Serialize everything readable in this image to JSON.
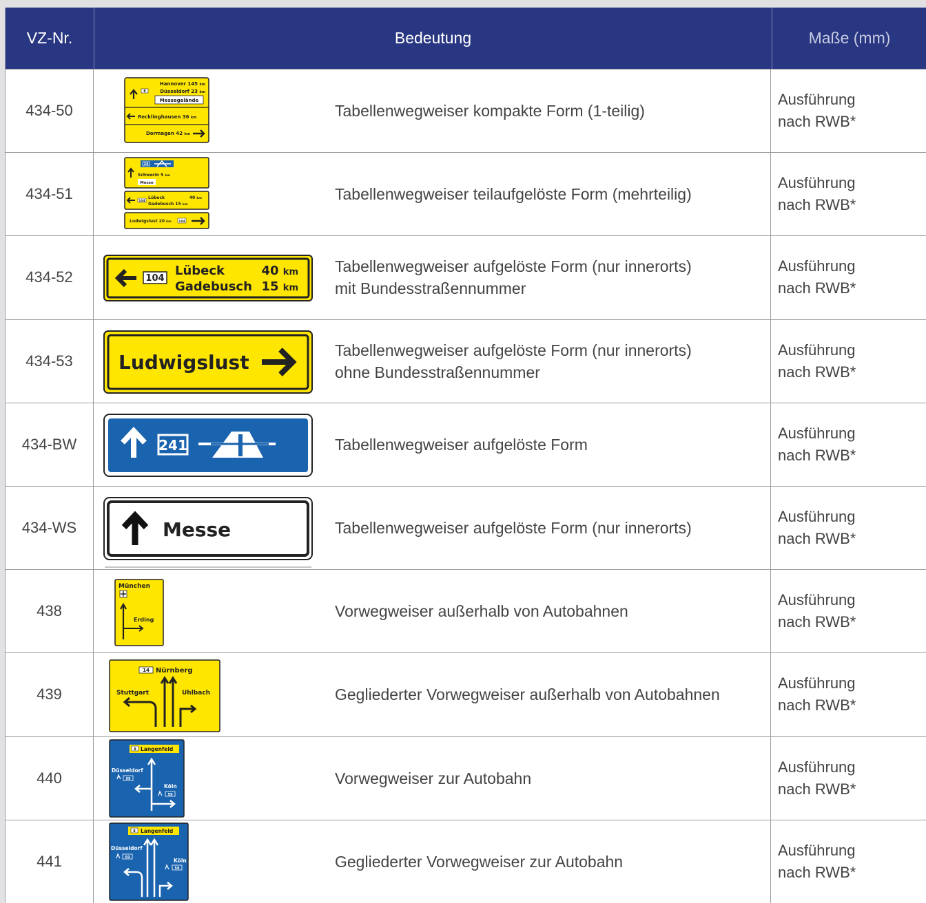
{
  "header": {
    "col_no": "VZ-Nr.",
    "col_meaning": "Bedeutung",
    "col_size": "Maße (mm)"
  },
  "rows": [
    {
      "no": "434-50",
      "meaning": "Tabellenwegweiser kompakte Form (1-teilig)",
      "size": "Ausführung\nnach RWB*",
      "sign": {
        "line1": "Hannover 145",
        "line2": "Düsseldorf 23",
        "route": "8",
        "box": "Messegelände",
        "line3": "Recklinghausen 36",
        "line4": "Dormagen 42",
        "unit": "km"
      }
    },
    {
      "no": "434-51",
      "meaning": "Tabellenwegweiser teilaufgelöste Form (mehrteilig)",
      "size": "Ausführung\nnach RWB*",
      "sign": {
        "route": "24",
        "line1": "Schwerin 5",
        "box": "Messe",
        "line2": "Lübeck",
        "km2": "40",
        "route2": "104",
        "line3": "Gadebusch 15",
        "line4": "Ludwigslust 20",
        "unit": "km"
      }
    },
    {
      "no": "434-52",
      "meaning": "Tabellenwegweiser aufgelöste Form (nur innerorts)\nmit Bundesstraßennummer",
      "size": "Ausführung\nnach RWB*",
      "sign": {
        "route": "104",
        "line1": "Lübeck",
        "km1": "40",
        "line2": "Gadebusch",
        "km2": "15",
        "unit": "km"
      }
    },
    {
      "no": "434-53",
      "meaning": "Tabellenwegweiser aufgelöste Form (nur innerorts)\nohne Bundesstraßennummer",
      "size": "Ausführung\nnach RWB*",
      "sign": {
        "line1": "Ludwigslust"
      }
    },
    {
      "no": "434-BW",
      "meaning": "Tabellenwegweiser aufgelöste Form",
      "size": "Ausführung\nnach RWB*",
      "sign": {
        "route": "241"
      }
    },
    {
      "no": "434-WS",
      "meaning": "Tabellenwegweiser aufgelöste Form (nur innerorts)",
      "size": "Ausführung\nnach RWB*",
      "sign": {
        "line1": "Messe"
      }
    },
    {
      "no": "438",
      "meaning": "Vorwegweiser außerhalb von Autobahnen",
      "size": "Ausführung\nnach RWB*",
      "sign": {
        "line1": "München",
        "line2": "Erding"
      }
    },
    {
      "no": "439",
      "meaning": "Gegliederter Vorwegweiser außerhalb von Autobahnen",
      "size": "Ausführung\nnach RWB*",
      "sign": {
        "route": "14",
        "line1": "Nürnberg",
        "line2": "Stuttgart",
        "line3": "Uhlbach"
      }
    },
    {
      "no": "440",
      "meaning": "Vorwegweiser zur Autobahn",
      "size": "Ausführung\nnach RWB*",
      "sign": {
        "route": "8",
        "line1": "Langenfeld",
        "line2": "Düsseldorf",
        "route2": "59",
        "line3": "Köln"
      }
    },
    {
      "no": "441",
      "meaning": "Gegliederter Vorwegweiser zur Autobahn",
      "size": "Ausführung\nnach RWB*",
      "sign": {
        "route": "8",
        "line1": "Langenfeld",
        "line2": "Düsseldorf",
        "route2": "59",
        "line3": "Köln"
      }
    }
  ],
  "colors": {
    "header_bg": "#293783",
    "sign_yellow": "#ffe600",
    "sign_blue": "#1a63ae",
    "text": "#444444"
  }
}
